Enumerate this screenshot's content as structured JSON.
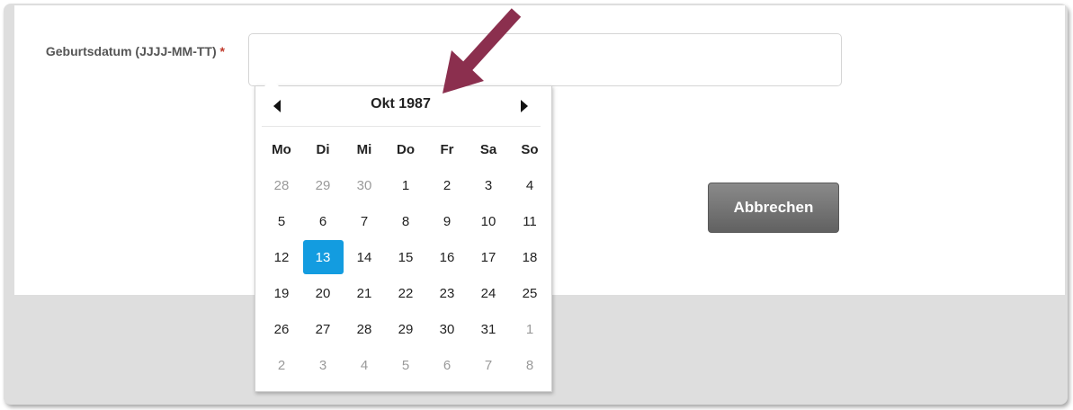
{
  "form": {
    "birthdate_label": "Geburtsdatum (JJJJ-MM-TT)",
    "required_marker": "*",
    "birthdate_value": "",
    "cancel_label": "Abbrechen"
  },
  "datepicker": {
    "month_title": "Okt 1987",
    "weekdays": [
      "Mo",
      "Di",
      "Mi",
      "Do",
      "Fr",
      "Sa",
      "So"
    ],
    "days": [
      {
        "label": "28",
        "muted": true
      },
      {
        "label": "29",
        "muted": true
      },
      {
        "label": "30",
        "muted": true
      },
      {
        "label": "1"
      },
      {
        "label": "2"
      },
      {
        "label": "3"
      },
      {
        "label": "4"
      },
      {
        "label": "5"
      },
      {
        "label": "6"
      },
      {
        "label": "7"
      },
      {
        "label": "8"
      },
      {
        "label": "9"
      },
      {
        "label": "10"
      },
      {
        "label": "11"
      },
      {
        "label": "12"
      },
      {
        "label": "13",
        "selected": true
      },
      {
        "label": "14"
      },
      {
        "label": "15"
      },
      {
        "label": "16"
      },
      {
        "label": "17"
      },
      {
        "label": "18"
      },
      {
        "label": "19"
      },
      {
        "label": "20"
      },
      {
        "label": "21"
      },
      {
        "label": "22"
      },
      {
        "label": "23"
      },
      {
        "label": "24"
      },
      {
        "label": "25"
      },
      {
        "label": "26"
      },
      {
        "label": "27"
      },
      {
        "label": "28"
      },
      {
        "label": "29"
      },
      {
        "label": "30"
      },
      {
        "label": "31"
      },
      {
        "label": "1",
        "muted": true
      },
      {
        "label": "2",
        "muted": true
      },
      {
        "label": "3",
        "muted": true
      },
      {
        "label": "4",
        "muted": true
      },
      {
        "label": "5",
        "muted": true
      },
      {
        "label": "6",
        "muted": true
      },
      {
        "label": "7",
        "muted": true
      },
      {
        "label": "8",
        "muted": true
      }
    ],
    "prev_icon": "triangle-left-icon",
    "next_icon": "triangle-right-icon"
  },
  "colors": {
    "selected_day": "#139ce0",
    "annotation_arrow": "#8b2f4e",
    "required_marker": "#c0392b",
    "cancel_button": "#6e6e6e"
  }
}
